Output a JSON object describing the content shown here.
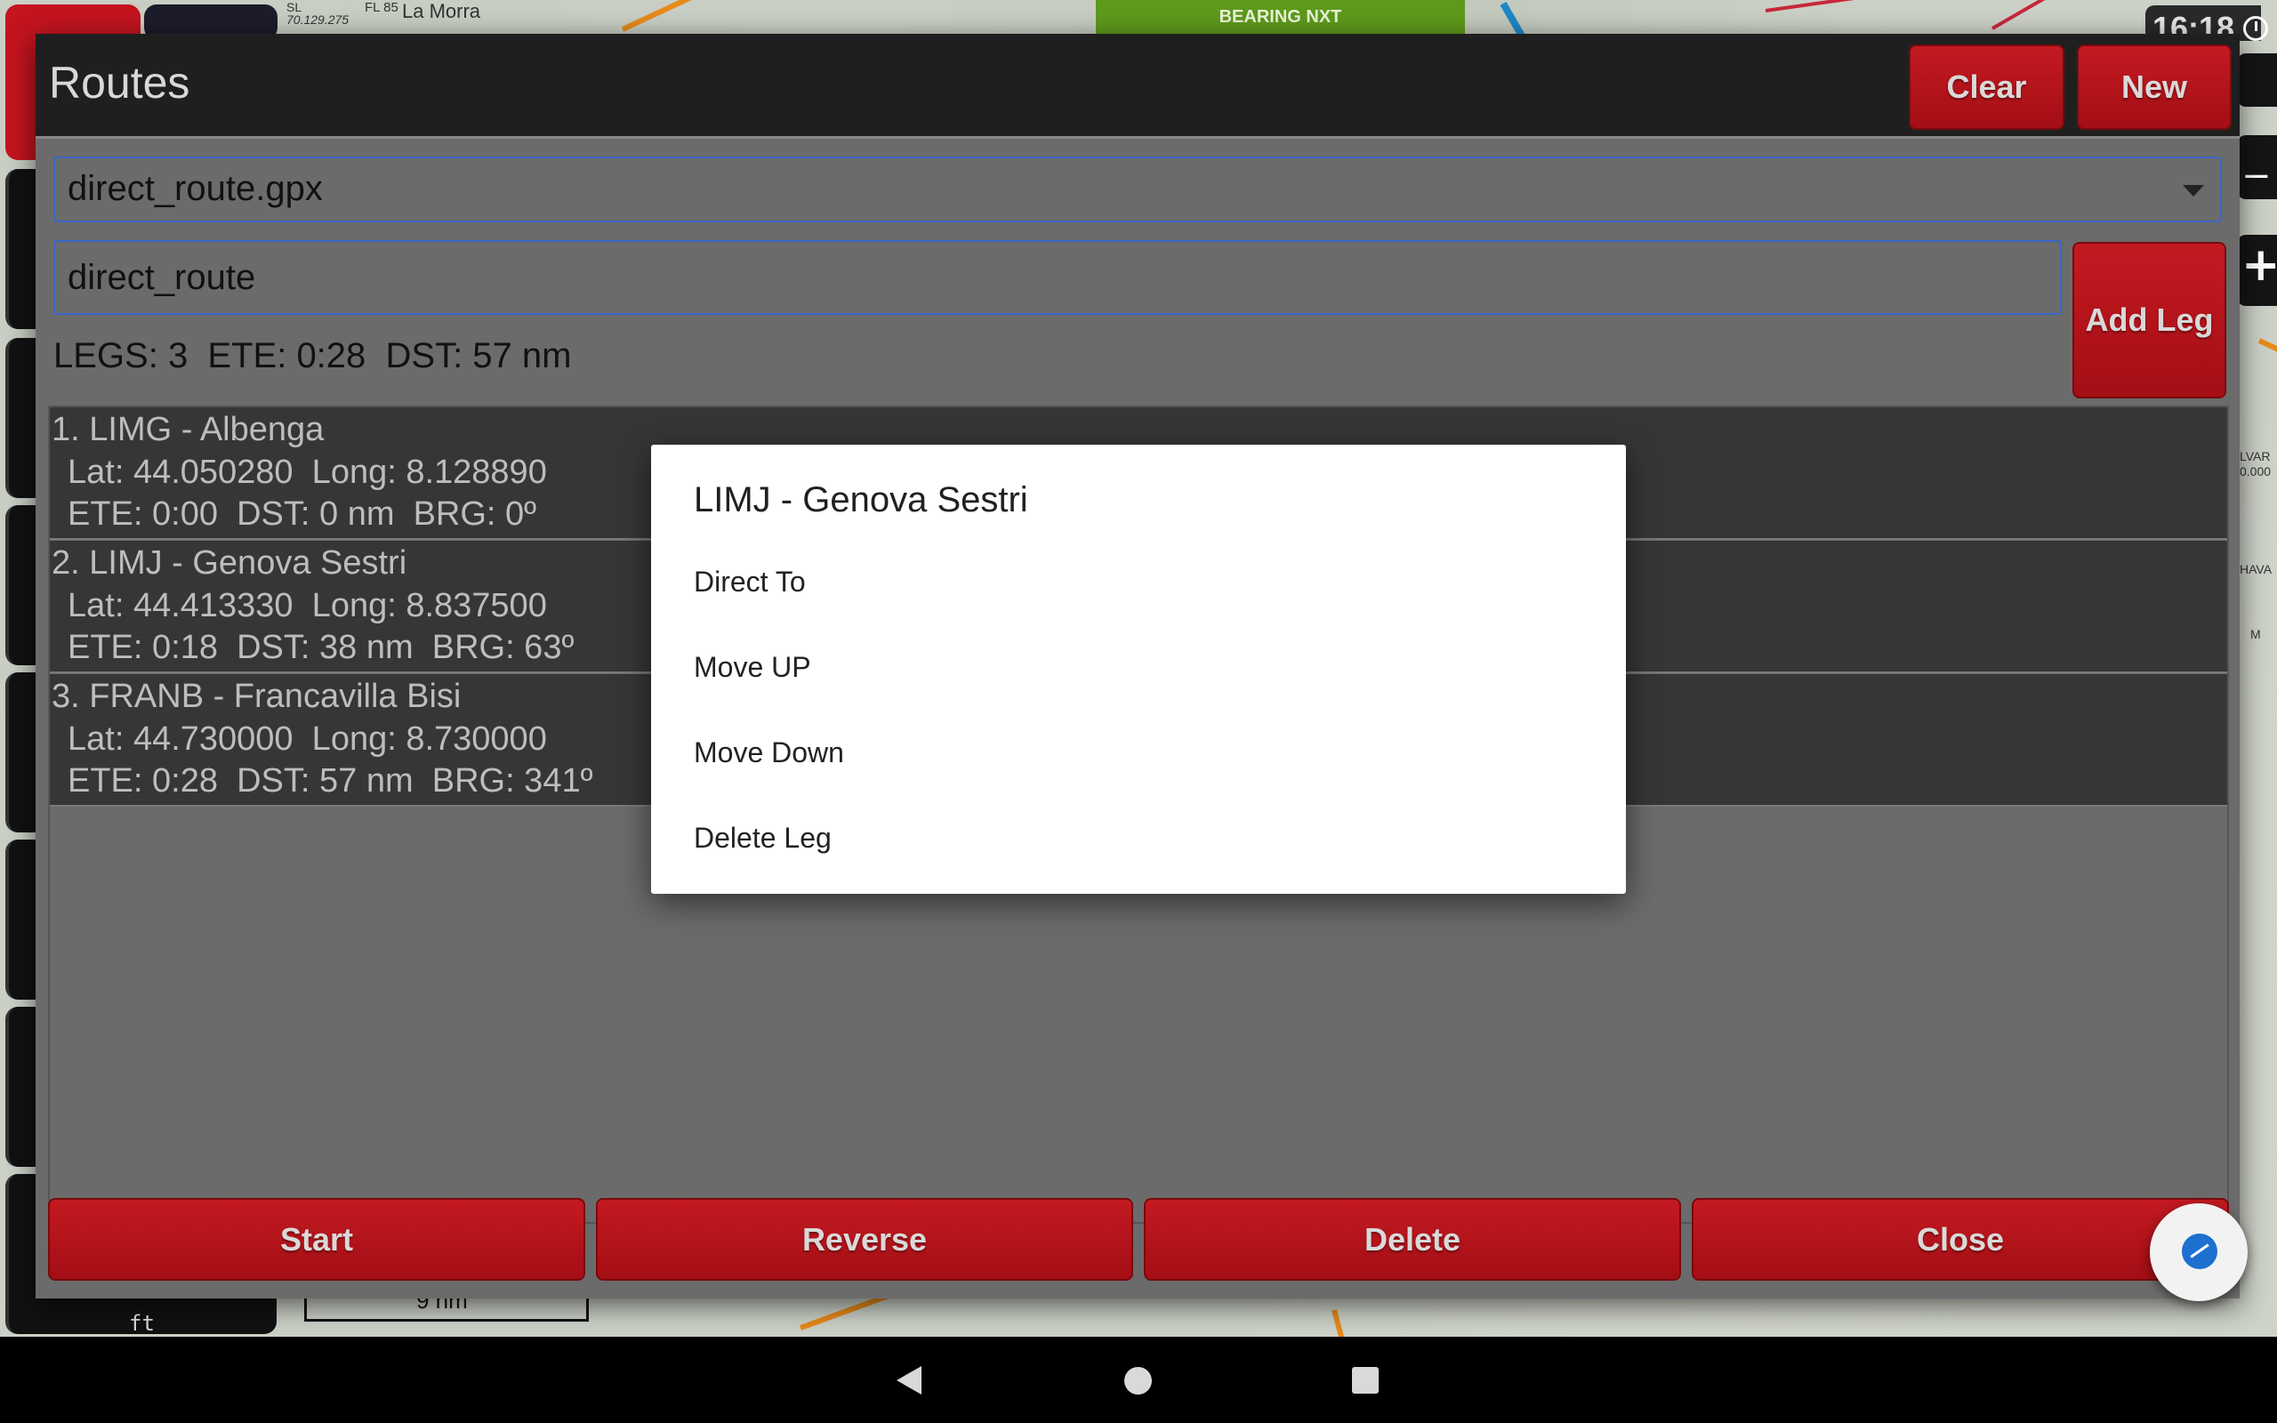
{
  "map": {
    "town_label": "La Morra",
    "fl_label": "FL 85",
    "sl_label": "SL",
    "freq_label": "70.129.275",
    "bearing_label": "BEARING NXT",
    "clock": "16:18",
    "right_labels": [
      "LVAR",
      "0.000",
      "HAVA",
      "M"
    ],
    "scale_label": "9 nm",
    "altitude_unit": "ft"
  },
  "routes": {
    "title": "Routes",
    "clear_label": "Clear",
    "new_label": "New",
    "file_selected": "direct_route.gpx",
    "route_name": "direct_route",
    "add_leg_label": "Add Leg",
    "summary": "LEGS: 3  ETE: 0:28  DST: 57 nm",
    "legs": [
      {
        "title": "1. LIMG - Albenga",
        "coords": "Lat: 44.050280  Long: 8.128890",
        "stats": "ETE: 0:00  DST: 0 nm  BRG: 0º"
      },
      {
        "title": "2. LIMJ - Genova Sestri",
        "coords": "Lat: 44.413330  Long: 8.837500",
        "stats": "ETE: 0:18  DST: 38 nm  BRG: 63º"
      },
      {
        "title": "3. FRANB - Francavilla Bisi",
        "coords": "Lat: 44.730000  Long: 8.730000",
        "stats": "ETE: 0:28  DST: 57 nm  BRG: 341º"
      }
    ],
    "start_label": "Start",
    "reverse_label": "Reverse",
    "delete_label": "Delete",
    "close_label": "Close"
  },
  "context_menu": {
    "title": "LIMJ - Genova Sestri",
    "items": [
      "Direct To",
      "Move UP",
      "Move Down",
      "Delete Leg"
    ]
  },
  "colors": {
    "accent_red": "#c41a22",
    "header_bg": "#1f1f1f",
    "panel_bg": "#6b6b6b",
    "row_bg": "#363636",
    "input_border": "#3b66c6",
    "bearing_green": "#5e9a1c"
  }
}
